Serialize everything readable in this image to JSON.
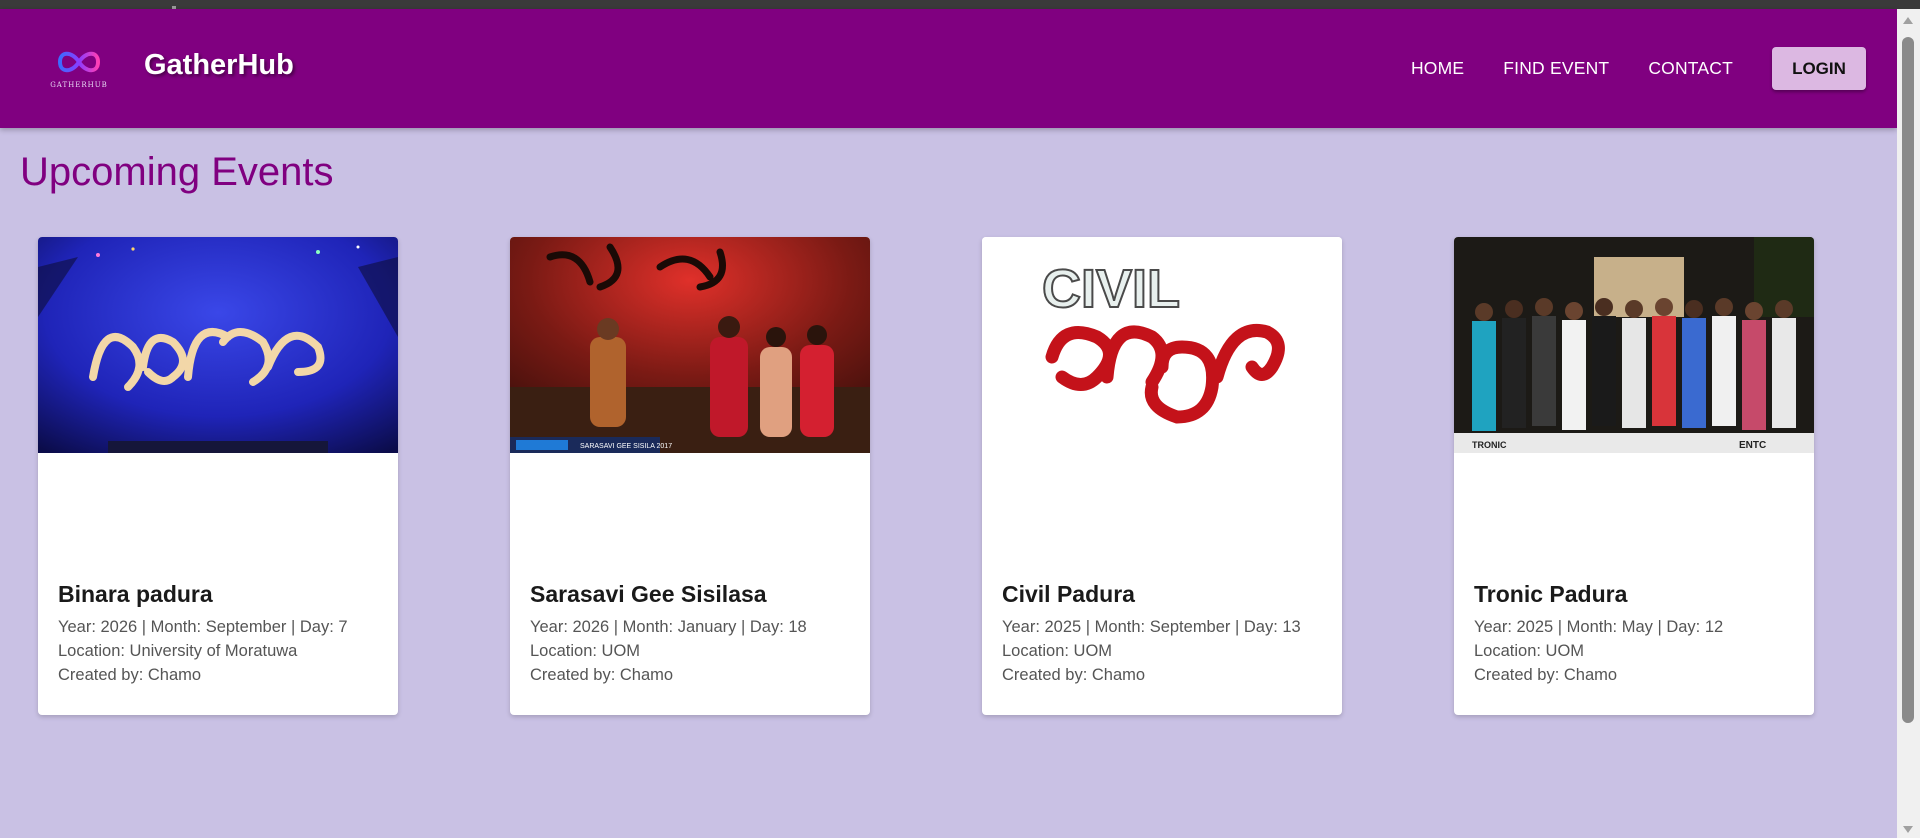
{
  "header": {
    "brand": "GatherHub",
    "logo_caption": "GATHERHUB",
    "logo_icon": "infinity-logo-icon",
    "nav": [
      "HOME",
      "FIND EVENT",
      "CONTACT"
    ],
    "login_label": "LOGIN"
  },
  "main": {
    "title": "Upcoming Events"
  },
  "events": [
    {
      "title": "Binara padura",
      "date": "Year: 2026 | Month: September | Day: 7",
      "location": "Location: University of Moratuwa",
      "created": "Created by: Chamo",
      "image": "stage-banner-photo"
    },
    {
      "title": "Sarasavi Gee Sisilasa",
      "date": "Year: 2026 | Month: January | Day: 18",
      "location": "Location: UOM",
      "created": "Created by: Chamo",
      "image": "award-ceremony-photo",
      "image_caption": "SARASAVI GEE SISILA 2017"
    },
    {
      "title": "Civil Padura",
      "date": "Year: 2025 | Month: September | Day: 13",
      "location": "Location: UOM",
      "created": "Created by: Chamo",
      "image": "civil-padura-logo",
      "image_text": "CIVIL"
    },
    {
      "title": "Tronic Padura",
      "date": "Year: 2025 | Month: May | Day: 12",
      "location": "Location: UOM",
      "created": "Created by: Chamo",
      "image": "group-photo",
      "image_caption": "TRONIC",
      "image_badge": "ENTC"
    }
  ],
  "colors": {
    "navbar": "#800080",
    "background": "#c9c1e4",
    "accent": "#800080",
    "login_button": "#dcb8e2"
  }
}
